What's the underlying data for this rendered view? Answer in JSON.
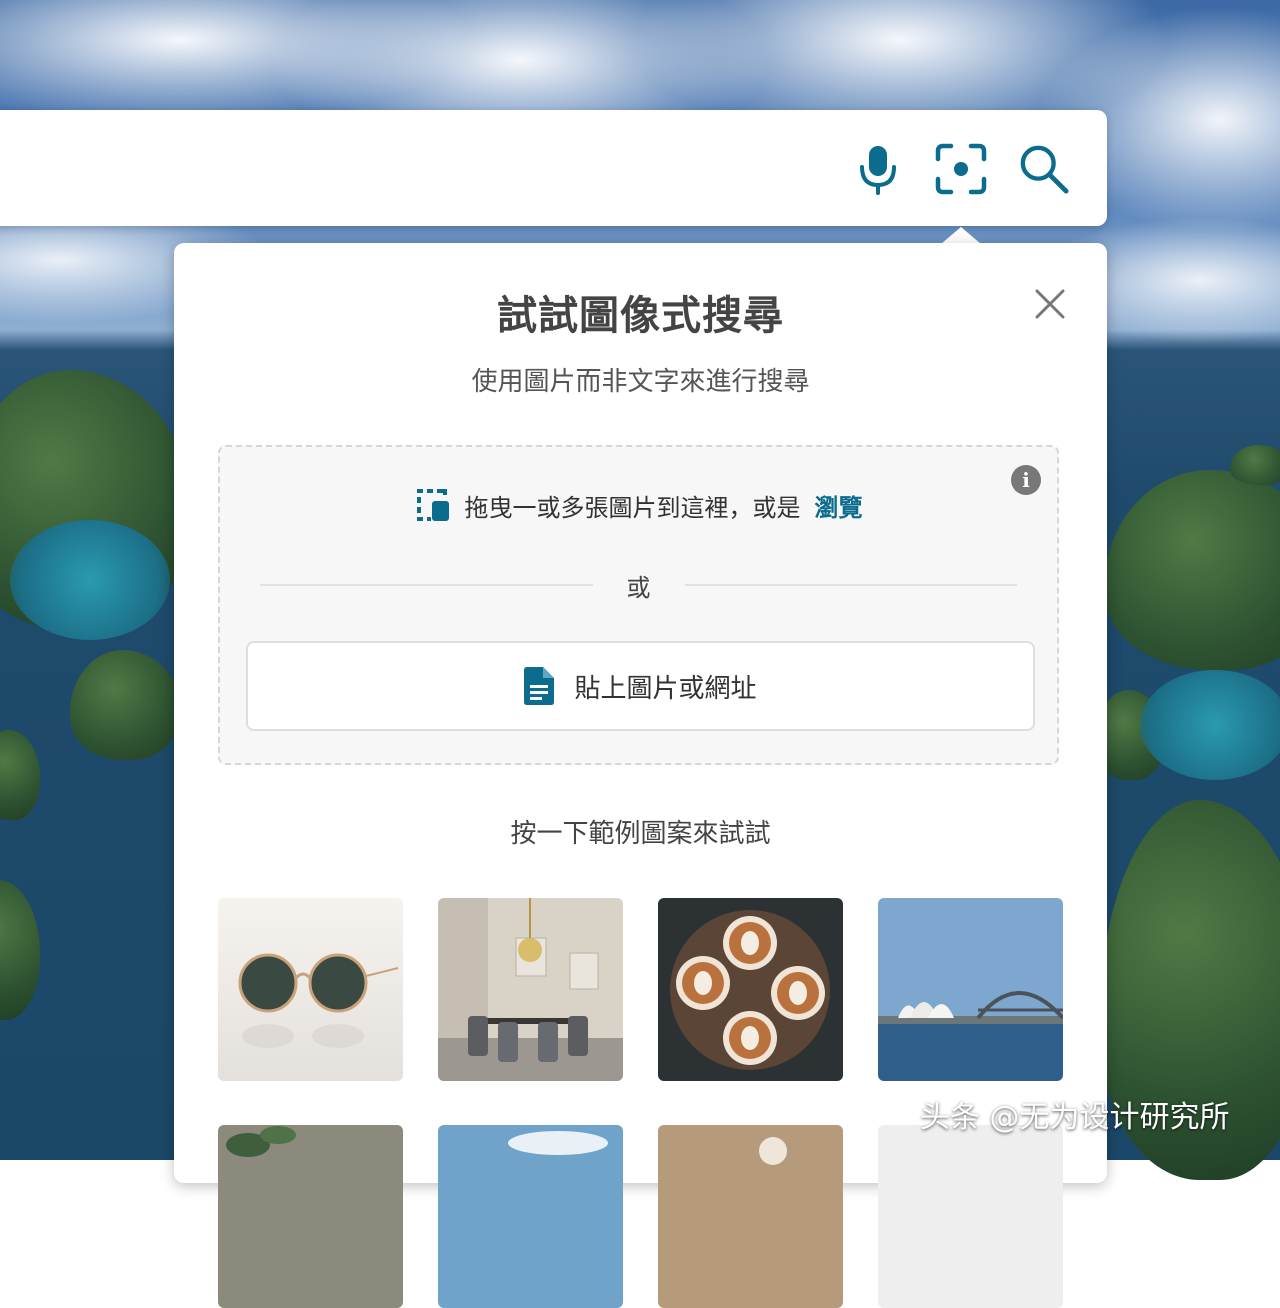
{
  "search": {
    "value": "",
    "mic_icon": "microphone-icon",
    "visual_search_icon": "camera-scan-icon",
    "search_icon": "magnifier-icon",
    "accent_color": "#0c6c8e"
  },
  "popup": {
    "title": "試試圖像式搜尋",
    "subtitle": "使用圖片而非文字來進行搜尋",
    "close_icon": "close-icon",
    "dropzone": {
      "drag_text": "拖曳一或多張圖片到這裡，或是",
      "browse_label": "瀏覽",
      "or_label": "或",
      "paste_label": "貼上圖片或網址",
      "info_icon": "info-icon"
    },
    "examples_title": "按一下範例圖案來試試",
    "examples": [
      {
        "subject": "sunglasses"
      },
      {
        "subject": "dining-room"
      },
      {
        "subject": "latte-art"
      },
      {
        "subject": "sydney-opera-house"
      },
      {
        "subject": "plant"
      },
      {
        "subject": "sky"
      },
      {
        "subject": "dandelion"
      },
      {
        "subject": "white"
      }
    ]
  },
  "watermark": "头条 @无为设计研究所"
}
